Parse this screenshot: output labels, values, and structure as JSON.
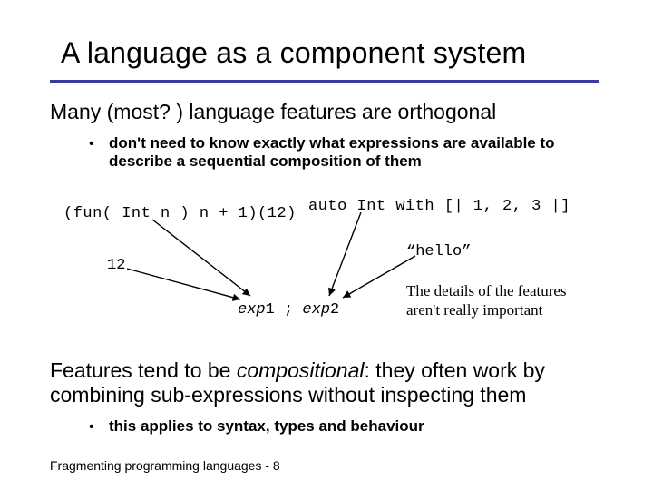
{
  "title": "A language as a component system",
  "p1": "Many (most? ) language features are orthogonal",
  "bullet1": "don't need to know exactly what expressions are available to describe a sequential composition of them",
  "code_fun": "(fun( Int n ) n + 1)(12)",
  "code_auto": "auto Int with [| 1, 2, 3 |]",
  "literal_12": "12",
  "literal_hello": "“hello”",
  "exp_seq_1": "exp",
  "exp_seq_1n": "1",
  "exp_seq_sep": " ; ",
  "exp_seq_2": "exp",
  "exp_seq_2n": "2",
  "sidenote": "The details of the features aren't really important",
  "p2_a": "Features tend to be ",
  "p2_em": "compositional",
  "p2_b": ":  they often work by combining sub-expressions without inspecting them",
  "bullet2": "this applies to syntax, types and behaviour",
  "footer": "Fragmenting programming languages  - 8"
}
